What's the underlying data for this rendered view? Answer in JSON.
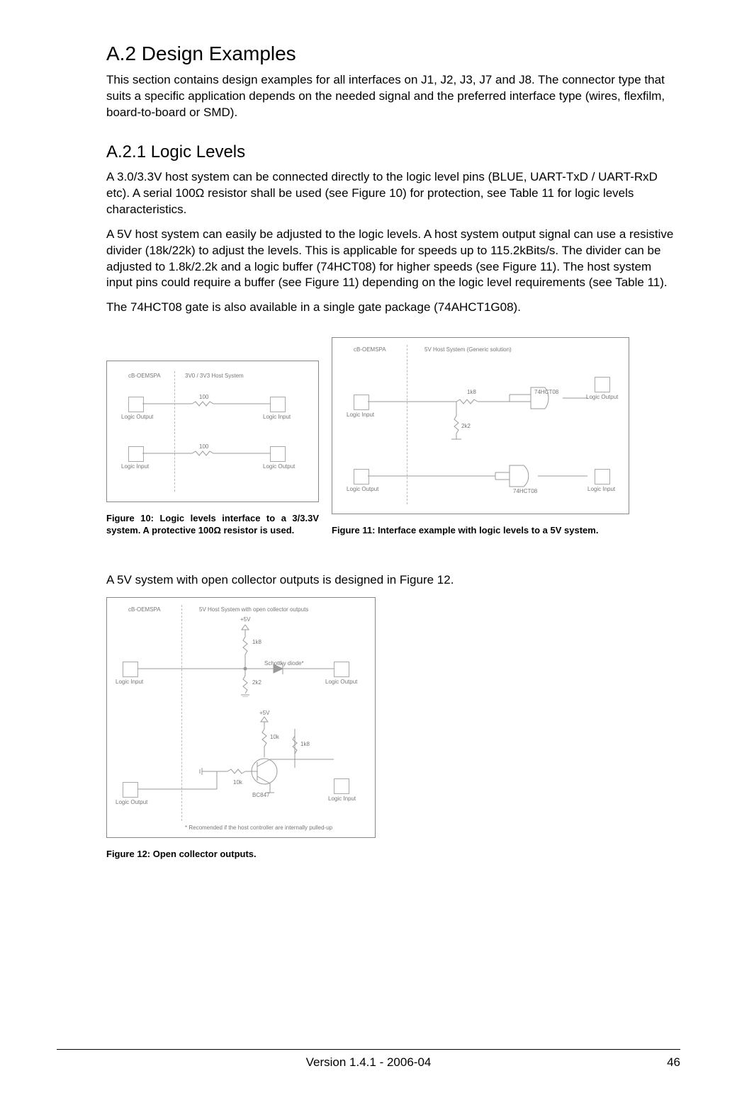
{
  "headings": {
    "h1": "A.2  Design Examples",
    "h2": "A.2.1   Logic Levels"
  },
  "paragraphs": {
    "p1": "This section contains design examples for all interfaces on J1, J2, J3, J7 and J8. The connector type that suits a specific application depends on the needed signal and the preferred interface type (wires, flexfilm, board-to-board or SMD).",
    "p2": "A 3.0/3.3V host system can be connected directly to the logic level pins (BLUE, UART-TxD / UART-RxD etc). A serial 100Ω resistor shall be used (see Figure 10) for protection, see Table 11 for logic levels characteristics.",
    "p3": "A 5V host system can easily be adjusted to the logic levels. A host system output signal can use a resistive divider (18k/22k) to adjust the levels. This is applicable for speeds up to 115.2kBits/s. The divider can be adjusted to 1.8k/2.2k and a logic buffer (74HCT08) for higher speeds (see Figure 11). The host system input pins could require a buffer (see Figure 11) depending on the logic level requirements (see Table 11).",
    "p4": "The 74HCT08 gate is also available in a single gate package (74AHCT1G08).",
    "p5": "A 5V system with open collector outputs is designed in Figure 12."
  },
  "figure10": {
    "caption": "Figure 10:   Logic levels interface to a 3/3.3V system. A protective 100Ω resistor is used.",
    "labels": {
      "left_hdr": "cB-OEMSPA",
      "right_hdr": "3V0 / 3V3 Host System",
      "logic_output": "Logic Output",
      "logic_input": "Logic Input",
      "r100": "100"
    }
  },
  "figure11": {
    "caption": "Figure 11:   Interface example with logic levels to a 5V system.",
    "labels": {
      "left_hdr": "cB-OEMSPA",
      "right_hdr": "5V Host System (Generic solution)",
      "logic_output": "Logic Output",
      "logic_input": "Logic Input",
      "r1k8": "1k8",
      "r2k2": "2k2",
      "ic": "74HCT08"
    }
  },
  "figure12": {
    "caption": "Figure 12:  Open collector outputs.",
    "labels": {
      "left_hdr": "cB-OEMSPA",
      "right_hdr": "5V Host System with open collector outputs",
      "logic_output": "Logic Output",
      "logic_input": "Logic Input",
      "p5v": "+5V",
      "r1k8": "1k8",
      "r2k2": "2k2",
      "r10k": "10k",
      "schottky": "Schottky diode*",
      "bc847": "BC847",
      "footnote": "* Recomended if the host controller are internally pulled-up"
    }
  },
  "footer": {
    "center": "Version 1.4.1 - 2006-04",
    "right": "46"
  }
}
